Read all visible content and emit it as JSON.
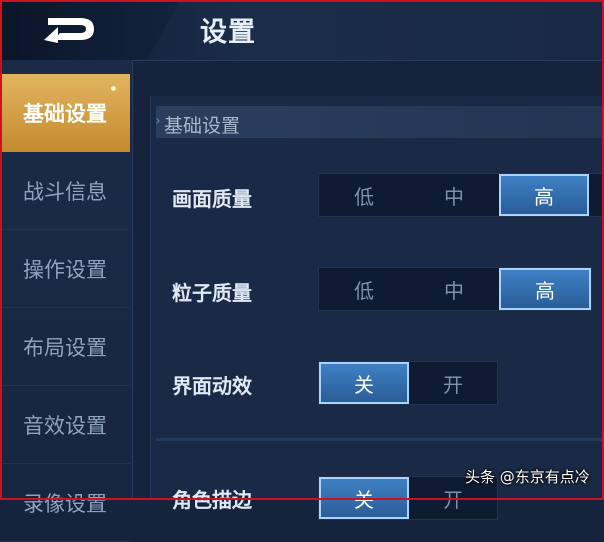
{
  "header": {
    "title": "设置"
  },
  "sidebar": {
    "items": [
      {
        "label": "基础设置"
      },
      {
        "label": "战斗信息"
      },
      {
        "label": "操作设置"
      },
      {
        "label": "布局设置"
      },
      {
        "label": "音效设置"
      },
      {
        "label": "录像设置"
      }
    ]
  },
  "main": {
    "section_title": "基础设置",
    "rows": [
      {
        "label": "画面质量",
        "options": [
          "低",
          "中",
          "高"
        ],
        "selected": "高"
      },
      {
        "label": "粒子质量",
        "options": [
          "低",
          "中",
          "高"
        ],
        "selected": "高"
      },
      {
        "label": "界面动效",
        "options": [
          "关",
          "开"
        ],
        "selected": "关"
      },
      {
        "label": "角色描边",
        "options": [
          "关",
          "开"
        ],
        "selected": "关"
      }
    ]
  },
  "watermark": "头条 @东京有点冷",
  "colors": {
    "accent": "#d9a84a",
    "selected": "#3570b0",
    "background": "#15233d"
  }
}
